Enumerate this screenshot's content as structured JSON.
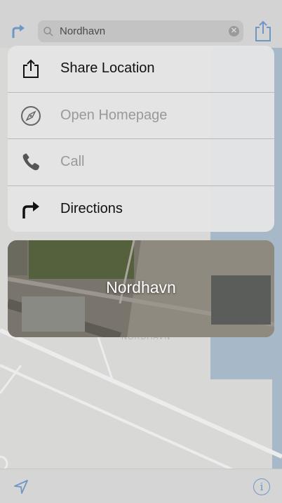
{
  "search": {
    "query": "Nordhavn",
    "clear_symbol": "✕"
  },
  "menu": {
    "items": [
      {
        "label": "Share Location",
        "icon": "share-icon",
        "enabled": true
      },
      {
        "label": "Open Homepage",
        "icon": "compass-icon",
        "enabled": false
      },
      {
        "label": "Call",
        "icon": "phone-icon",
        "enabled": false
      },
      {
        "label": "Directions",
        "icon": "directions-arrow-icon",
        "enabled": true
      }
    ]
  },
  "card": {
    "title": "Nordhavn"
  },
  "map": {
    "place_label": "NORDHAVN"
  },
  "bottom": {
    "info_symbol": "i"
  },
  "colors": {
    "accent": "#6f97c4",
    "dim_text": "#999999",
    "water": "#a9bccc"
  }
}
